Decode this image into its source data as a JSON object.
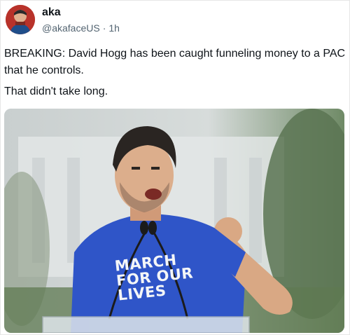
{
  "post": {
    "display_name": "aka",
    "handle": "@akafaceUS",
    "separator": "·",
    "time": "1h",
    "paragraphs": [
      "BREAKING: David Hogg has been caught funneling money to a PAC that he controls.",
      "That didn't take long."
    ]
  },
  "media": {
    "shirt_lines": [
      "MARCH",
      "FOR OUR",
      "LIVES"
    ]
  },
  "colors": {
    "name": "#0f1419",
    "meta": "#536471",
    "shirt": "#2f55c8",
    "background_building": "#dfe4e6",
    "background_trees": "#4f6b4a"
  }
}
